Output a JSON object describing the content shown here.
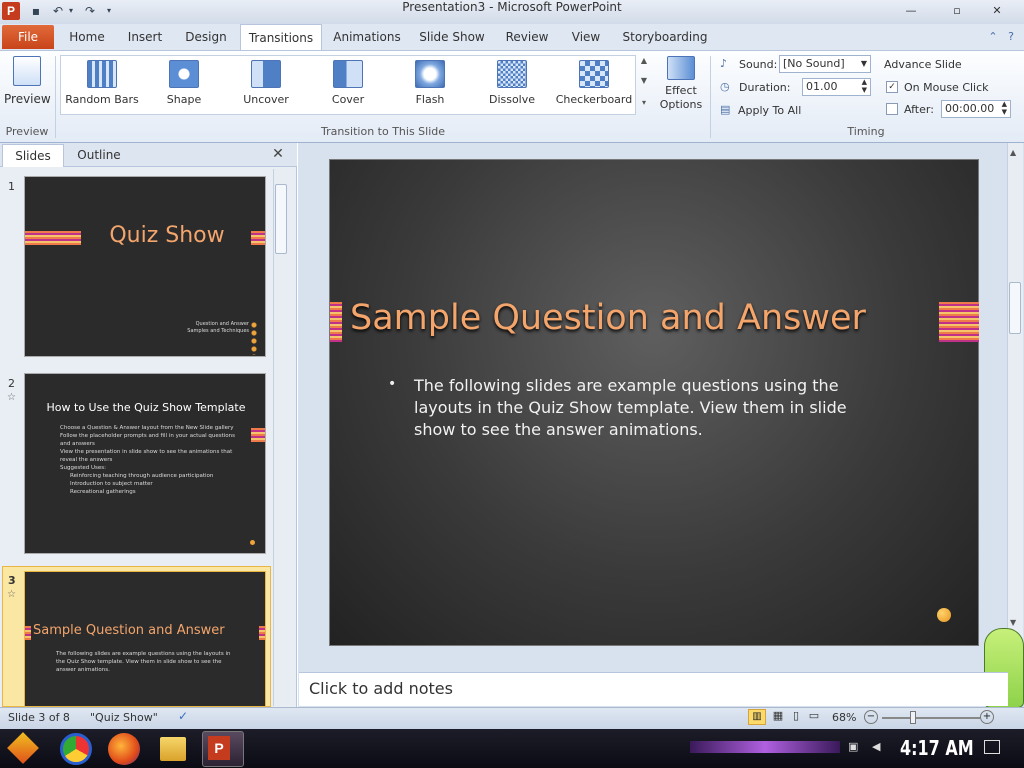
{
  "window": {
    "title": "Presentation3 - Microsoft PowerPoint"
  },
  "qat": {
    "app_icon": "P"
  },
  "tabs": {
    "file": "File",
    "items": [
      "Home",
      "Insert",
      "Design",
      "Transitions",
      "Animations",
      "Slide Show",
      "Review",
      "View",
      "Storyboarding"
    ],
    "active": "Transitions"
  },
  "ribbon": {
    "preview_label": "Preview",
    "preview_group": "Preview",
    "transitions": [
      "Random Bars",
      "Shape",
      "Uncover",
      "Cover",
      "Flash",
      "Dissolve",
      "Checkerboard"
    ],
    "effect_options": "Effect Options",
    "transition_group": "Transition to This Slide",
    "sound_label": "Sound:",
    "sound_value": "[No Sound]",
    "duration_label": "Duration:",
    "duration_value": "01.00",
    "apply_all": "Apply To All",
    "advance_slide": "Advance Slide",
    "on_mouse_click": "On Mouse Click",
    "on_mouse_click_checked": true,
    "after_label": "After:",
    "after_value": "00:00.00",
    "timing_group": "Timing"
  },
  "pane": {
    "tab_slides": "Slides",
    "tab_outline": "Outline",
    "thumbs": [
      {
        "num": "1",
        "title": "Quiz Show",
        "sub1": "Question and Answer",
        "sub2": "Samples and Techniques"
      },
      {
        "num": "2",
        "title": "How to Use the Quiz Show Template",
        "bullets": [
          "Choose a Question & Answer layout from the New Slide gallery",
          "Follow the placeholder prompts and fill in your actual questions and answers",
          "View the presentation in slide show to see the animations that reveal the answers",
          "Suggested Uses:"
        ],
        "subbullets": [
          "Reinforcing teaching through audience participation",
          "Introduction to subject matter",
          "Recreational gatherings"
        ]
      },
      {
        "num": "3",
        "title": "Sample Question and Answer",
        "body": "The following slides are example questions using the layouts in the Quiz Show template. View them in slide show to see the answer animations."
      }
    ]
  },
  "slide": {
    "title": "Sample Question and Answer",
    "bullet": "The following slides are example questions using the layouts in the Quiz Show template.  View them in slide show to see the answer animations."
  },
  "notes": {
    "placeholder": "Click to add notes"
  },
  "status": {
    "slide_info": "Slide 3 of 8",
    "theme": "\"Quiz Show\"",
    "zoom": "68%"
  },
  "taskbar": {
    "clock": "4:17 AM"
  },
  "colors": {
    "title_orange": "#f3a56c",
    "accent": "#c9441a"
  }
}
